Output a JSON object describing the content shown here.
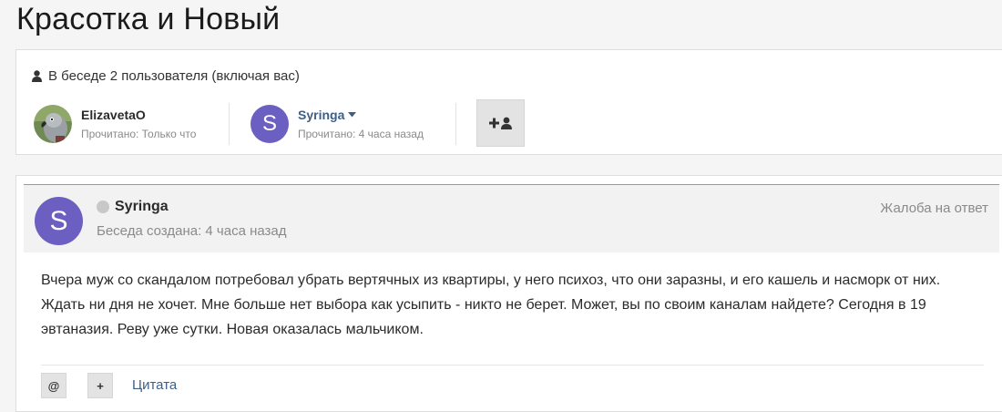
{
  "page": {
    "title": "Красотка и Новый"
  },
  "participants": {
    "header": "В беседе 2 пользователя (включая вас)",
    "items": [
      {
        "name": "ElizavetaO",
        "status": "Прочитано: Только что",
        "avatar": "parrot-photo"
      },
      {
        "name": "Syringa",
        "status": "Прочитано: 4 часа назад",
        "avatar_letter": "S",
        "has_dropdown": true
      }
    ],
    "add_user_icon": "add-user-icon"
  },
  "post": {
    "avatar_letter": "S",
    "author": "Syringa",
    "date": "Беседа создана: 4 часа назад",
    "report": "Жалоба на ответ",
    "body": "Вчера муж со скандалом потребовал убрать вертячных из квартиры, у него психоз, что они заразны, и его кашель и насморк от них. Ждать ни дня не хочет. Мне больше нет выбора как усыпить - никто не берет.  Может, вы по своим каналам найдете? Сегодня в 19 эвтаназия. Реву уже сутки. Новая оказалась мальчиком.",
    "tools": {
      "mention": "@",
      "multiquote": "+",
      "quote": "Цитата"
    }
  },
  "colors": {
    "accent_avatar": "#6b5fc1",
    "link": "#3d5f86",
    "muted": "#8a8a8a"
  }
}
